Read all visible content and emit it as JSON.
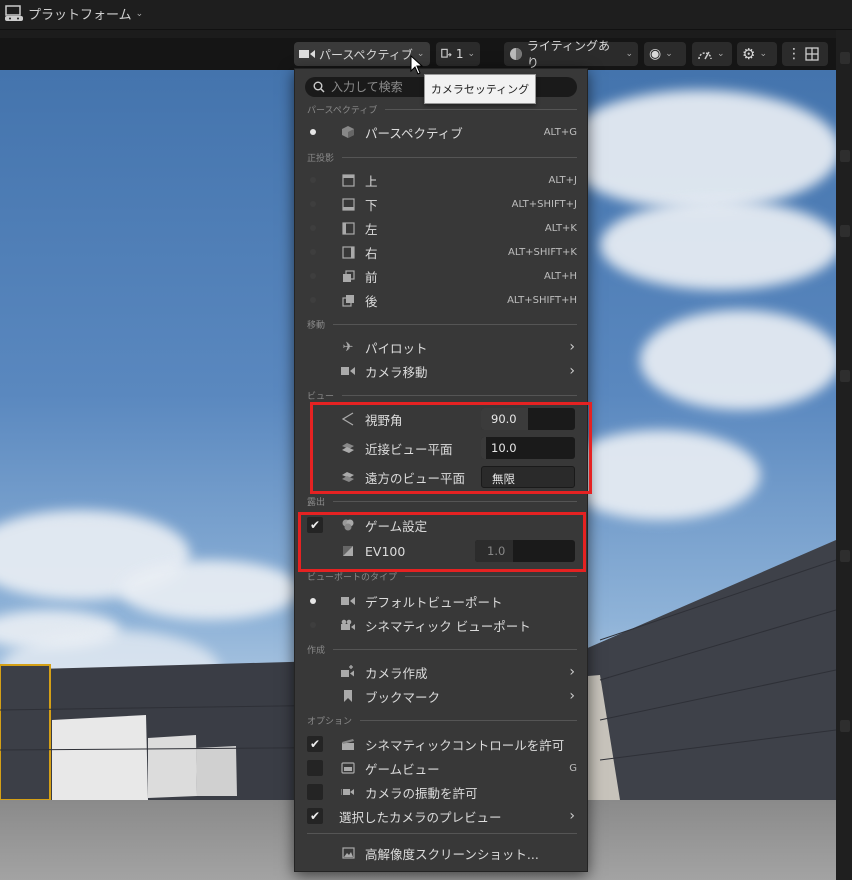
{
  "topbar": {
    "platform_label": "プラットフォーム"
  },
  "toolbar": {
    "perspective_label": "パースペクティブ",
    "view_count": "1",
    "lighting_label": "ライティングあり"
  },
  "tooltip": "カメラセッティング",
  "search": {
    "placeholder": "入力して検索"
  },
  "sections": {
    "perspective": "パースペクティブ",
    "ortho": "正投影",
    "move": "移動",
    "view": "ビュー",
    "exposure": "露出",
    "viewport_type": "ビューポートのタイプ",
    "create": "作成",
    "options": "オプション"
  },
  "items": {
    "perspective": {
      "label": "パースペクティブ",
      "shortcut": "ALT+G"
    },
    "top": {
      "label": "上",
      "shortcut": "ALT+J"
    },
    "bottom": {
      "label": "下",
      "shortcut": "ALT+SHIFT+J"
    },
    "left": {
      "label": "左",
      "shortcut": "ALT+K"
    },
    "right": {
      "label": "右",
      "shortcut": "ALT+SHIFT+K"
    },
    "front": {
      "label": "前",
      "shortcut": "ALT+H"
    },
    "back": {
      "label": "後",
      "shortcut": "ALT+SHIFT+H"
    },
    "pilot": {
      "label": "パイロット"
    },
    "camera_move": {
      "label": "カメラ移動"
    },
    "fov": {
      "label": "視野角",
      "value": "90.0",
      "fill_fraction": 0.5
    },
    "near_plane": {
      "label": "近接ビュー平面",
      "value": "10.0",
      "fill_fraction": 0.05
    },
    "far_plane": {
      "label": "遠方のビュー平面",
      "value": "無限"
    },
    "game_settings": {
      "label": "ゲーム設定",
      "checked": true
    },
    "ev100": {
      "label": "EV100",
      "value": "1.0"
    },
    "default_viewport": {
      "label": "デフォルトビューポート"
    },
    "cinematic_viewport": {
      "label": "シネマティック ビューポート"
    },
    "create_camera": {
      "label": "カメラ作成"
    },
    "bookmark": {
      "label": "ブックマーク"
    },
    "allow_cinematic": {
      "label": "シネマティックコントロールを許可",
      "checked": true
    },
    "game_view": {
      "label": "ゲームビュー",
      "shortcut": "G",
      "checked": false
    },
    "allow_shake": {
      "label": "カメラの振動を許可",
      "checked": false
    },
    "preview_selected": {
      "label": "選択したカメラのプレビュー",
      "checked": true
    },
    "hires_screenshot": {
      "label": "高解像度スクリーンショット..."
    }
  },
  "colors": {
    "highlight_box": "#e52222",
    "menu_bg": "#383838"
  }
}
